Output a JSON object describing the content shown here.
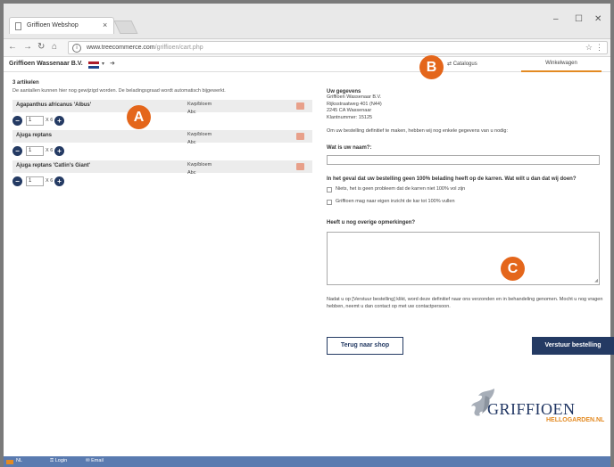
{
  "browser": {
    "tab_title": "Griffioen Webshop",
    "tab_close": "×",
    "url_host": "www.treecommerce.com",
    "url_path": "/griffioen/cart.php",
    "win_min": "–",
    "win_max": "☐",
    "win_close": "✕"
  },
  "header": {
    "company": "Griffioen Wassenaar B.V.",
    "flag_colors": [
      "#ae1c28",
      "#ffffff",
      "#21468b"
    ],
    "nav_catalogus": "Catalogus",
    "nav_orders": "Winkelwagen"
  },
  "cart": {
    "count": "3 artikelen",
    "note": "De aantallen kunnen hier nog gewijzigd worden. De beladingsgraad wordt automatisch bijgewerkt.",
    "items": [
      {
        "name": "Agapanthus africanus 'Albus'",
        "unit": "Kwp/bloem",
        "abc": "Abc",
        "qty": "1",
        "mult": "X 6"
      },
      {
        "name": "Ajuga reptans",
        "unit": "Kwp/bloem",
        "abc": "Abc",
        "qty": "1",
        "mult": "X 6"
      },
      {
        "name": "Ajuga reptans 'Catlin's Giant'",
        "unit": "Kwp/bloem",
        "abc": "Abc",
        "qty": "1",
        "mult": "X 6"
      }
    ]
  },
  "form": {
    "title": "Uw gegevens",
    "address": [
      "Griffioen Wassenaar B.V.",
      "Rijksstraatweg 401 (N44)",
      "2245 CA Wassenaar",
      "Klantnummer: 15125"
    ],
    "intro": "Om uw bestelling definitief te maken, hebben wij nog enkele gegevens van u nodig:",
    "q_name": "Wat is uw naam?:",
    "q_load": "In het geval dat uw bestelling geen 100% belading heeft op de karren. Wat wilt u dan dat wij doen?",
    "opt1": "Niets, het is geen probleem dat de karren niet 100% vol zijn",
    "opt2": "Griffioen mag naar eigen inzicht de kar tot 100% vullen",
    "q_remarks": "Heeft u nog overige opmerkingen?",
    "footer": "Nadat u op [Verstuur bestelling] klikt, word deze definitief naar ons verzonden en in behandeling genomen. Mocht u nog vragen hebben, neemt u dan contact op met uw contactpersoon.",
    "btn_back": "Terug naar shop",
    "btn_send": "Verstuur bestelling"
  },
  "logo": {
    "word": "GRIFFIOEN",
    "sub": "HELLOGARDEN.NL"
  },
  "bottom": {
    "nl": "NL",
    "login": "Login",
    "email": "Email"
  },
  "markers": {
    "a": "A",
    "b": "B",
    "c": "C"
  },
  "colors": {
    "navy": "#243a63",
    "orange": "#e38a22",
    "marker": "#e4661b",
    "bottombar": "#5a7bb0"
  }
}
